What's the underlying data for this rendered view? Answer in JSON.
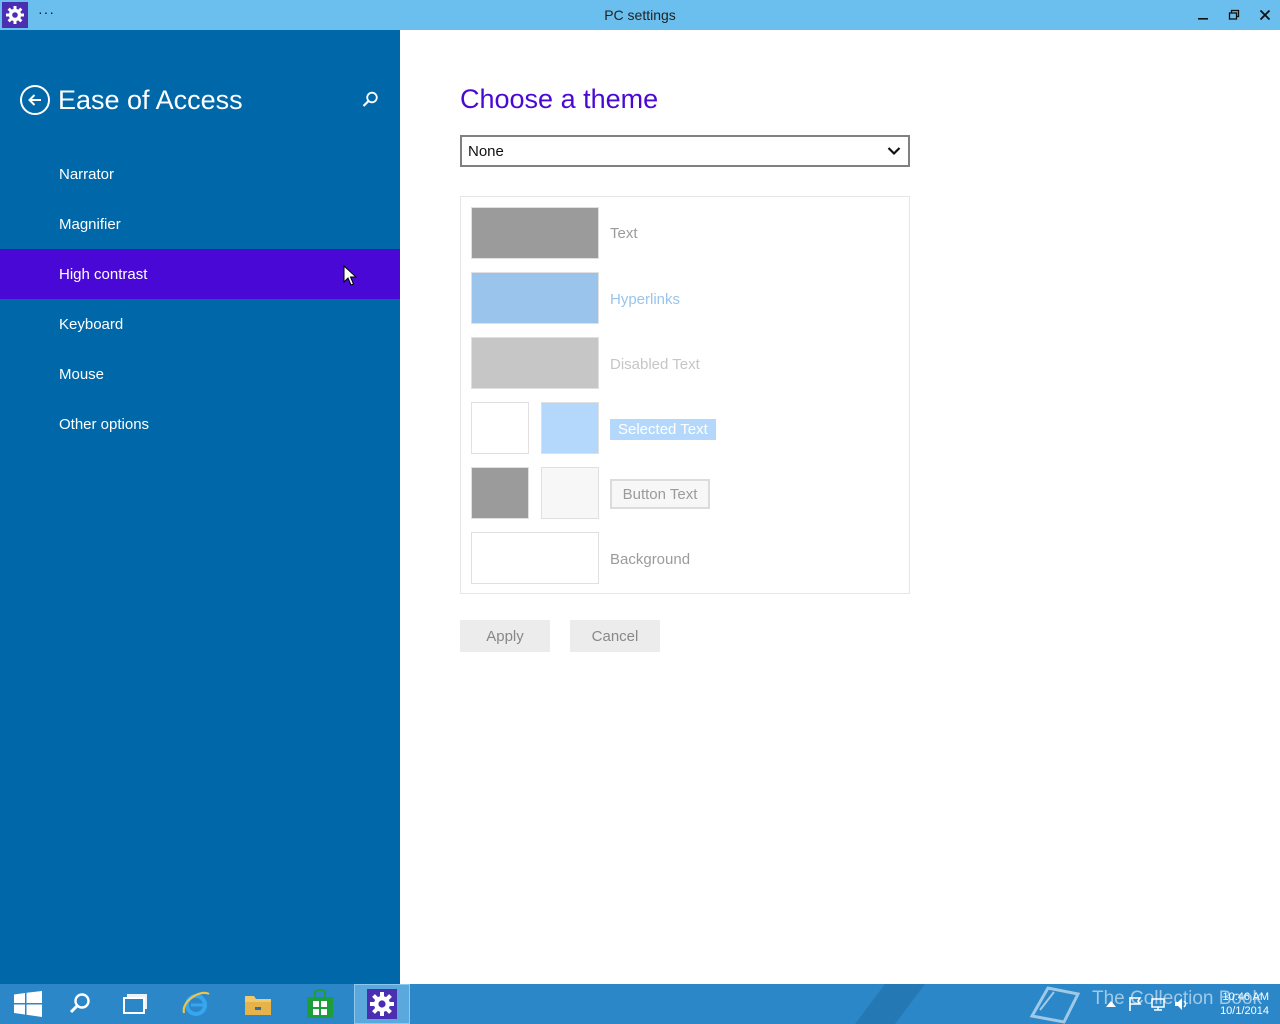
{
  "window": {
    "title": "PC settings",
    "menu_dots": "···"
  },
  "sidebar": {
    "heading": "Ease of Access",
    "items": [
      {
        "label": "Narrator"
      },
      {
        "label": "Magnifier"
      },
      {
        "label": "High contrast",
        "selected": true
      },
      {
        "label": "Keyboard"
      },
      {
        "label": "Mouse"
      },
      {
        "label": "Other options"
      }
    ]
  },
  "content": {
    "title": "Choose a theme",
    "theme_select": {
      "value": "None"
    },
    "preview": {
      "text_label": "Text",
      "hyperlinks_label": "Hyperlinks",
      "disabled_label": "Disabled Text",
      "selected_label": "Selected Text",
      "button_label": "Button Text",
      "background_label": "Background"
    },
    "apply_label": "Apply",
    "cancel_label": "Cancel"
  },
  "taskbar": {
    "time": "10:46 AM",
    "date": "10/1/2014",
    "watermark": "The Collection Book"
  },
  "colors": {
    "accent": "#4a08d6",
    "sidebar": "#0068a8",
    "titlebar": "#6bbfee",
    "taskbar": "#2b87c8"
  }
}
